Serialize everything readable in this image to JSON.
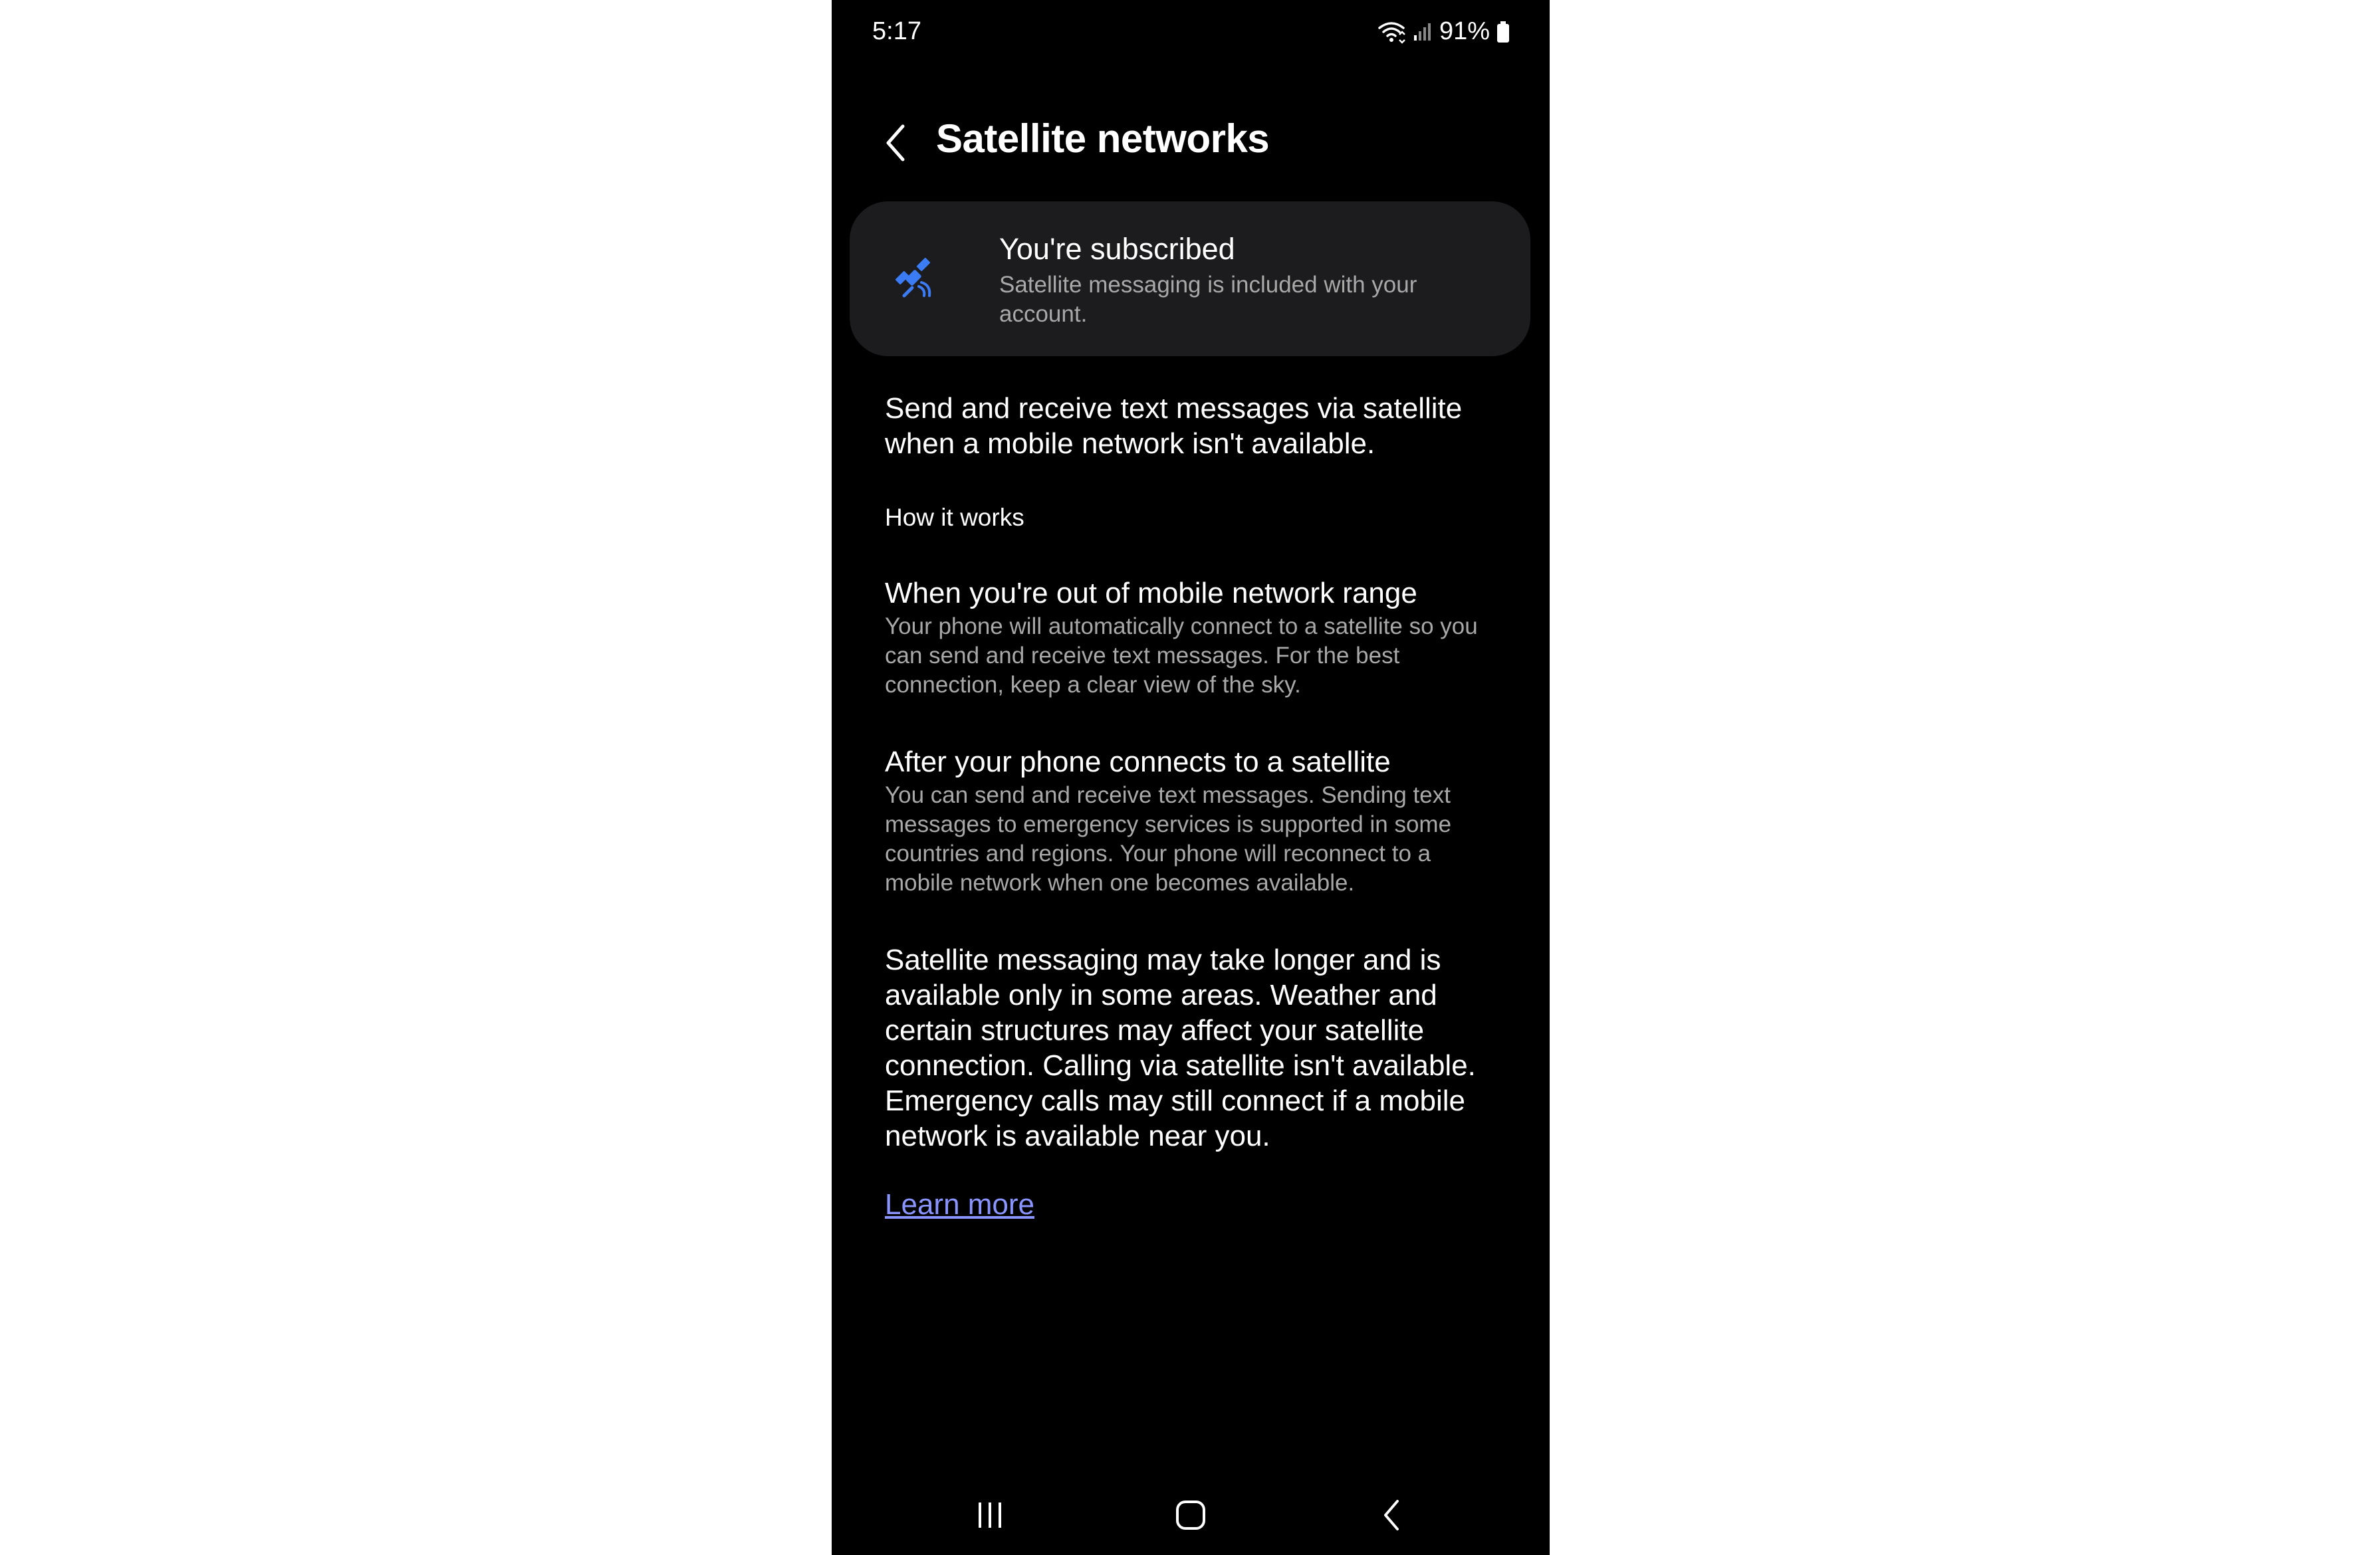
{
  "status_bar": {
    "time": "5:17",
    "battery": "91%",
    "icons": [
      "wifi-calling-icon",
      "signal-icon",
      "battery-icon"
    ]
  },
  "header": {
    "title": "Satellite networks",
    "back_icon": "chevron-left-icon"
  },
  "subscription": {
    "icon": "satellite-icon",
    "title": "You're subscribed",
    "description": "Satellite messaging is included with your account."
  },
  "intro": "Send and receive text messages via satellite when a mobile network isn't available.",
  "how_it_works": {
    "label": "How it works",
    "items": [
      {
        "title": "When you're out of mobile network range",
        "description": "Your phone will automatically connect to a satellite so you can send and receive text messages. For the best connection, keep a clear view of the sky."
      },
      {
        "title": "After your phone connects to a satellite",
        "description": "You can send and receive text messages. Sending text messages to emergency services is supported in some countries and regions. Your phone will reconnect to a mobile network when one becomes available."
      }
    ]
  },
  "disclaimer": "Satellite messaging may take longer and is available only in some areas. Weather and certain structures may affect your satellite connection. Calling via satellite isn't available. Emergency calls may still connect if a mobile network is available near you.",
  "learn_more": "Learn more",
  "nav_bar": {
    "recents_icon": "recents-icon",
    "home_icon": "home-icon",
    "back_icon": "back-icon"
  },
  "colors": {
    "background": "#000000",
    "card": "#1c1c1e",
    "secondary_text": "#a8a8a8",
    "link": "#8a94ff",
    "accent_icon": "#3b7cf5"
  }
}
